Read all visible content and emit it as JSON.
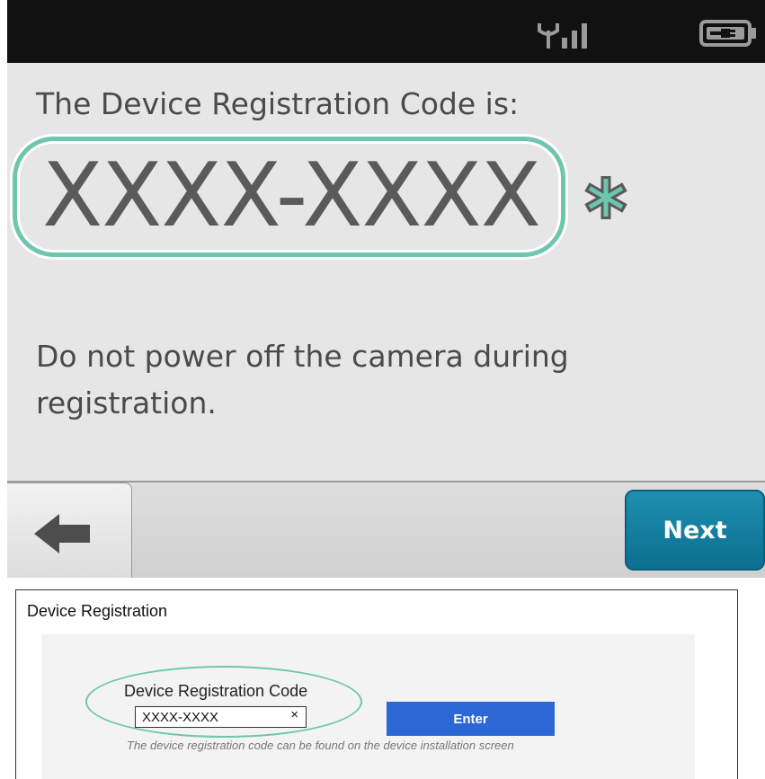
{
  "camera_screen": {
    "title": "The Device Registration Code is:",
    "code": "XXXX-XXXX",
    "code_marker": "*",
    "warning": "Do not power off the camera during registration.",
    "next_label": "Next",
    "icons": {
      "signal": "signal-antenna-icon",
      "battery": "battery-plug-icon",
      "back": "back-arrow-icon",
      "marker": "asterisk-icon"
    },
    "colors": {
      "accent": "#6ec6ad",
      "next_button": "#1680a3",
      "status_bar": "#111111"
    }
  },
  "web_form": {
    "title": "Device Registration",
    "field_label": "Device Registration Code",
    "input_value": "XXXX-XXXX",
    "clear_label": "×",
    "enter_label": "Enter",
    "helper_text": "The device registration code can be found on the device installation screen",
    "colors": {
      "enter_button": "#2c67d6",
      "highlight": "#6ec6ad"
    }
  }
}
